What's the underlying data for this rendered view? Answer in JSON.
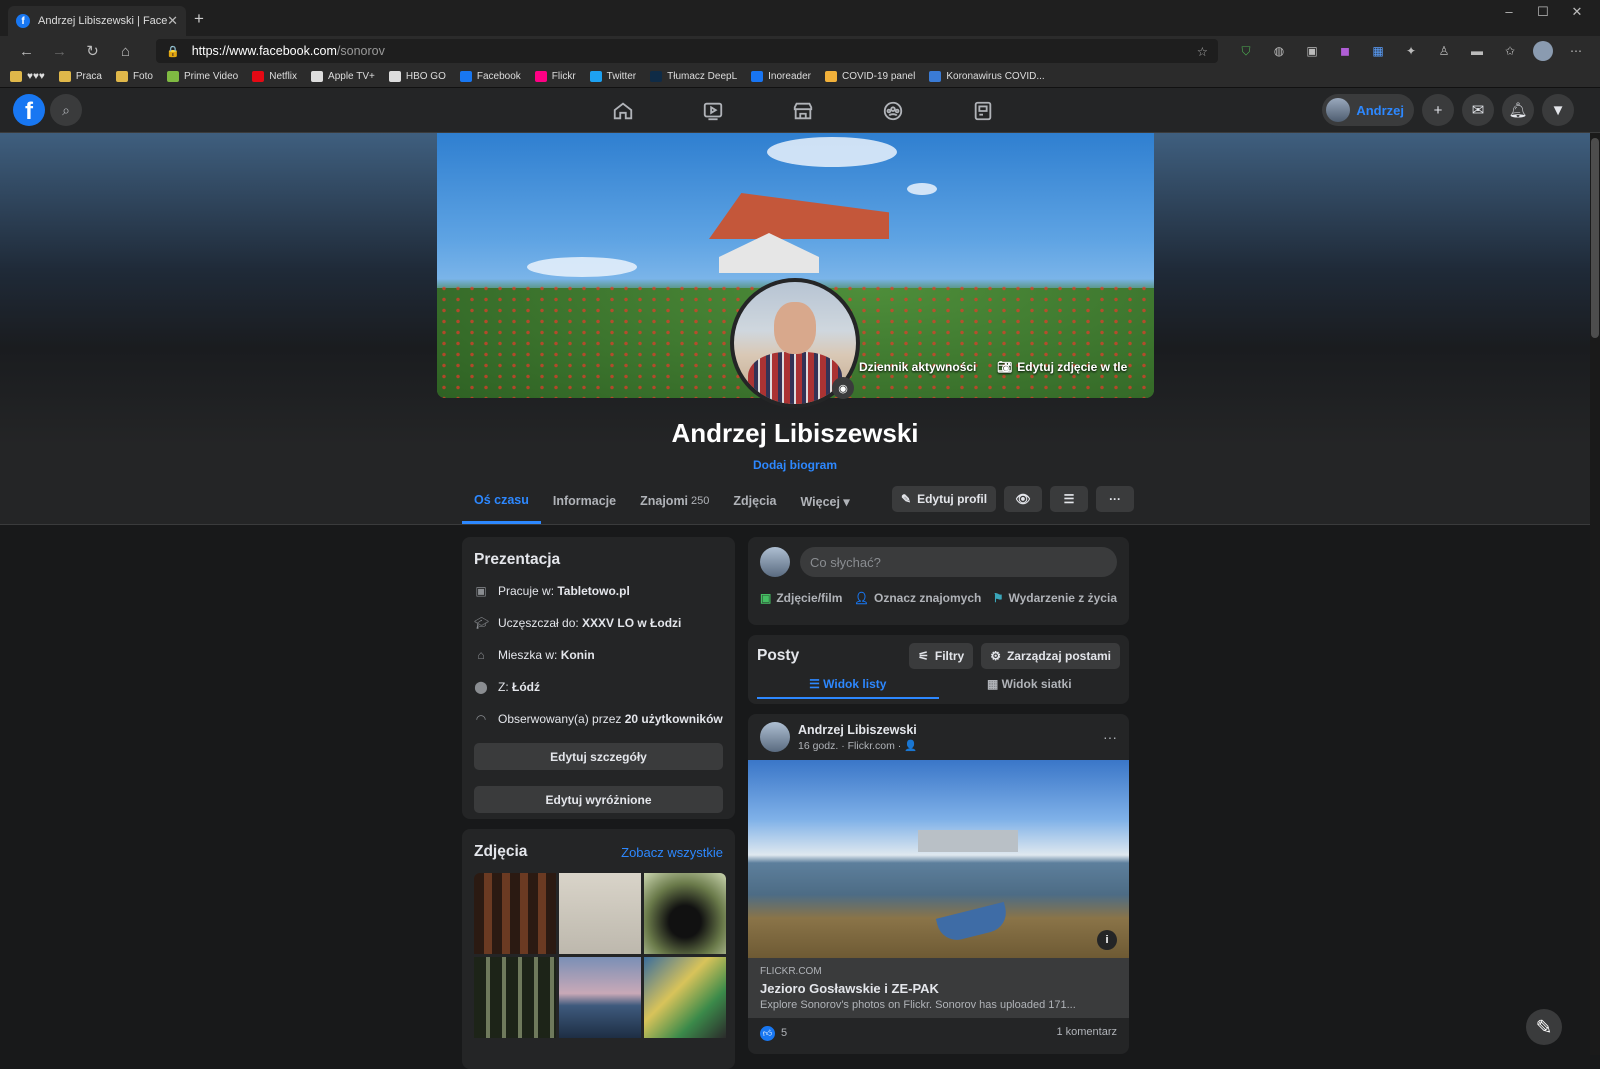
{
  "browser": {
    "tab_title": "Andrzej Libiszewski | Facebook",
    "tab_close": "✕",
    "new_tab": "+",
    "url_host": "https://www.facebook.com",
    "url_path": "/sonorov",
    "bookmarks": [
      {
        "label": "♥♥♥",
        "color": "#e0b84a"
      },
      {
        "label": "Praca",
        "color": "#e0b84a"
      },
      {
        "label": "Foto",
        "color": "#e0b84a"
      },
      {
        "label": "Prime Video",
        "color": "#7fba42"
      },
      {
        "label": "Netflix",
        "color": "#e50914"
      },
      {
        "label": "Apple TV+",
        "color": "#dddddd"
      },
      {
        "label": "HBO GO",
        "color": "#dddddd"
      },
      {
        "label": "Facebook",
        "color": "#1877f2"
      },
      {
        "label": "Flickr",
        "color": "#ff0084"
      },
      {
        "label": "Twitter",
        "color": "#1da1f2"
      },
      {
        "label": "Tłumacz DeepL",
        "color": "#0f2b46"
      },
      {
        "label": "Inoreader",
        "color": "#1875f3"
      },
      {
        "label": "COVID-19 panel",
        "color": "#f2b13a"
      },
      {
        "label": "Koronawirus COVID...",
        "color": "#3a7bd5"
      }
    ]
  },
  "fb": {
    "brand_color": "#1877f2",
    "user_short": "Andrzej",
    "profile_name": "Andrzej Libiszewski",
    "add_bio": "Dodaj biogram",
    "activity_log": "Dziennik aktywności",
    "edit_cover": "Edytuj zdjęcie w tle",
    "tabs": [
      {
        "label": "Oś czasu",
        "active": true
      },
      {
        "label": "Informacje"
      },
      {
        "label": "Znajomi",
        "count": "250"
      },
      {
        "label": "Zdjęcia"
      },
      {
        "label": "Więcej ▾"
      }
    ],
    "edit_profile": "Edytuj profil",
    "intro": {
      "title": "Prezentacja",
      "items": [
        {
          "icon": "briefcase-icon",
          "prefix": "Pracuje w: ",
          "value": "Tabletowo.pl"
        },
        {
          "icon": "graduation-cap-icon",
          "prefix": "Uczęszczał do: ",
          "value": "XXXV LO w Łodzi"
        },
        {
          "icon": "home-icon",
          "prefix": "Mieszka w: ",
          "value": "Konin"
        },
        {
          "icon": "location-pin-icon",
          "prefix": "Z: ",
          "value": "Łódź"
        },
        {
          "icon": "rss-icon",
          "prefix": "Obserwowany(a) przez ",
          "value": "20 użytkowników"
        }
      ],
      "edit_details": "Edytuj szczegóły",
      "edit_featured": "Edytuj wyróżnione"
    },
    "photos": {
      "title": "Zdjęcia",
      "see_all": "Zobacz wszystkie"
    },
    "composer": {
      "placeholder": "Co słychać?",
      "actions": [
        "Zdjęcie/film",
        "Oznacz znajomych",
        "Wydarzenie z życia"
      ]
    },
    "posts": {
      "title": "Posty",
      "filters": "Filtry",
      "manage": "Zarządzaj postami",
      "list_view": "Widok listy",
      "grid_view": "Widok siatki"
    },
    "post": {
      "author": "Andrzej Libiszewski",
      "meta": "16 godz. · Flickr.com · 👤",
      "link_domain": "FLICKR.COM",
      "link_title": "Jezioro Gosławskie i ZE-PAK",
      "link_desc": "Explore Sonorov's photos on Flickr. Sonorov has uploaded 171...",
      "likes": "5",
      "comments": "1 komentarz"
    }
  }
}
